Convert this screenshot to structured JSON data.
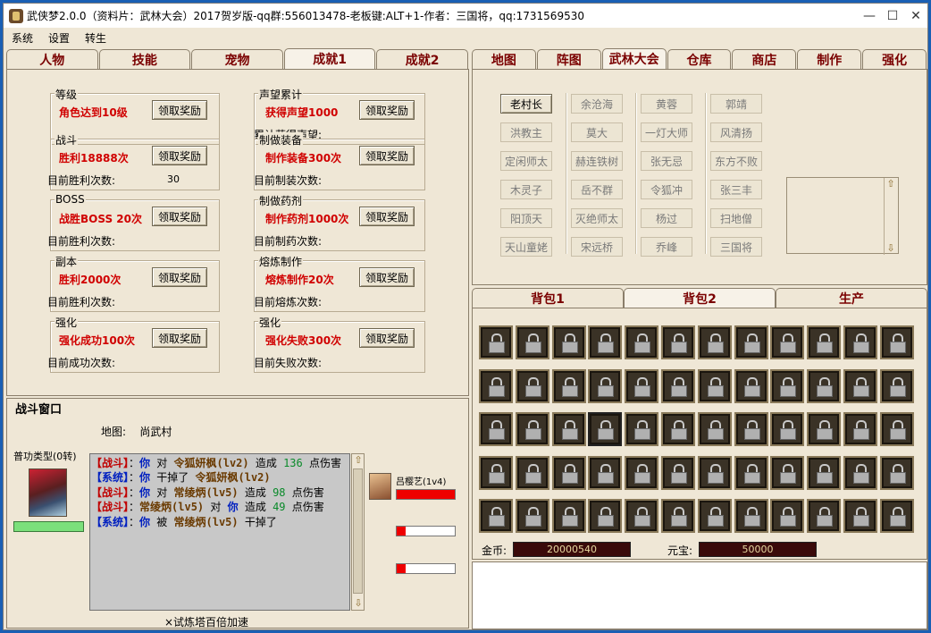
{
  "window": {
    "title": "武侠梦2.0.0（资料片：武林大会）2017贺岁版-qq群:556013478-老板键:ALT+1-作者：三国将，qq:1731569530"
  },
  "menu": [
    "系统",
    "设置",
    "转生"
  ],
  "left_tabs": [
    "人物",
    "技能",
    "宠物",
    "成就1",
    "成就2"
  ],
  "right_tabs": [
    "地图",
    "阵图",
    "武林大会",
    "仓库",
    "商店",
    "制作",
    "强化"
  ],
  "achievements_left": [
    {
      "group": "等级",
      "goal": "角色达到10级",
      "button": "领取奖励",
      "sub": "",
      "value": ""
    },
    {
      "group": "战斗",
      "goal": "胜利18888次",
      "button": "领取奖励",
      "sub": "目前胜利次数:",
      "value": "30"
    },
    {
      "group": "BOSS",
      "goal": "战胜BOSS 20次",
      "button": "领取奖励",
      "sub": "目前胜利次数:",
      "value": ""
    },
    {
      "group": "副本",
      "goal": "胜利2000次",
      "button": "领取奖励",
      "sub": "目前胜利次数:",
      "value": ""
    },
    {
      "group": "强化",
      "goal": "强化成功100次",
      "button": "领取奖励",
      "sub": "目前成功次数:",
      "value": ""
    }
  ],
  "achievements_right": [
    {
      "group": "声望累计",
      "goal": "获得声望1000",
      "button": "领取奖励",
      "sub": "累计获得声望:"
    },
    {
      "group": "制做装备",
      "goal": "制作装备300次",
      "button": "领取奖励",
      "sub": "目前制装次数:"
    },
    {
      "group": "制做药剂",
      "goal": "制作药剂1000次",
      "button": "领取奖励",
      "sub": "目前制药次数:"
    },
    {
      "group": "熔炼制作",
      "goal": "熔炼制作20次",
      "button": "领取奖励",
      "sub": "目前熔炼次数:"
    },
    {
      "group": "强化",
      "goal": "强化失败300次",
      "button": "领取奖励",
      "sub": "目前失败次数:"
    }
  ],
  "battle": {
    "title": "战斗窗口",
    "map_label": "地图:",
    "map_name": "尚武村",
    "attack_type": "普功类型(0转)",
    "log": [
      [
        [
          "【战斗】",
          "r"
        ],
        [
          "：",
          "t"
        ],
        [
          "你",
          "b"
        ],
        [
          " 对 ",
          "t"
        ],
        [
          "令狐妍枫(lv2)",
          "n"
        ],
        [
          " 造成 ",
          "t"
        ],
        [
          "136",
          "g"
        ],
        [
          " 点伤害",
          "t"
        ]
      ],
      [
        [
          "【系统】",
          "b"
        ],
        [
          "：",
          "t"
        ],
        [
          "你",
          "b"
        ],
        [
          " 干掉了 ",
          "t"
        ],
        [
          "令狐妍枫(lv2)",
          "n"
        ]
      ],
      [
        [
          "【战斗】",
          "r"
        ],
        [
          "：",
          "t"
        ],
        [
          "你",
          "b"
        ],
        [
          " 对 ",
          "t"
        ],
        [
          "常绫炳(lv5)",
          "n"
        ],
        [
          " 造成 ",
          "t"
        ],
        [
          "98",
          "g"
        ],
        [
          " 点伤害",
          "t"
        ]
      ],
      [
        [
          "【战斗】",
          "r"
        ],
        [
          "：",
          "t"
        ],
        [
          "常绫炳(lv5)",
          "n"
        ],
        [
          " 对 ",
          "t"
        ],
        [
          "你",
          "b"
        ],
        [
          " 造成 ",
          "t"
        ],
        [
          "49",
          "g"
        ],
        [
          " 点伤害",
          "t"
        ]
      ],
      [
        [
          "【系统】",
          "b"
        ],
        [
          "：",
          "t"
        ],
        [
          "你",
          "b"
        ],
        [
          " 被 ",
          "t"
        ],
        [
          "常绫炳(lv5)",
          "n"
        ],
        [
          " 干掉了",
          "t"
        ]
      ]
    ],
    "trial": "×试炼塔百倍加速",
    "enemy_name": "吕樱艺(1v4)",
    "enemy_hp": [
      1.0,
      0.15,
      0.15
    ],
    "player_hp": 1.0
  },
  "npcs": [
    [
      "老村长",
      "洪教主",
      "定闲师太",
      "木灵子",
      "阳顶天",
      "天山童姥"
    ],
    [
      "余沧海",
      "莫大",
      "赫连铁树",
      "岳不群",
      "灭绝师太",
      "宋远桥"
    ],
    [
      "黄蓉",
      "一灯大师",
      "张无忌",
      "令狐冲",
      "杨过",
      "乔峰"
    ],
    [
      "郭靖",
      "风清扬",
      "东方不败",
      "张三丰",
      "扫地僧",
      "三国将"
    ]
  ],
  "bag_tabs": [
    "背包1",
    "背包2",
    "生产"
  ],
  "currency": {
    "gold_label": "金币:",
    "gold": "20000540",
    "yuanbao_label": "元宝:",
    "yuanbao": "50000"
  }
}
